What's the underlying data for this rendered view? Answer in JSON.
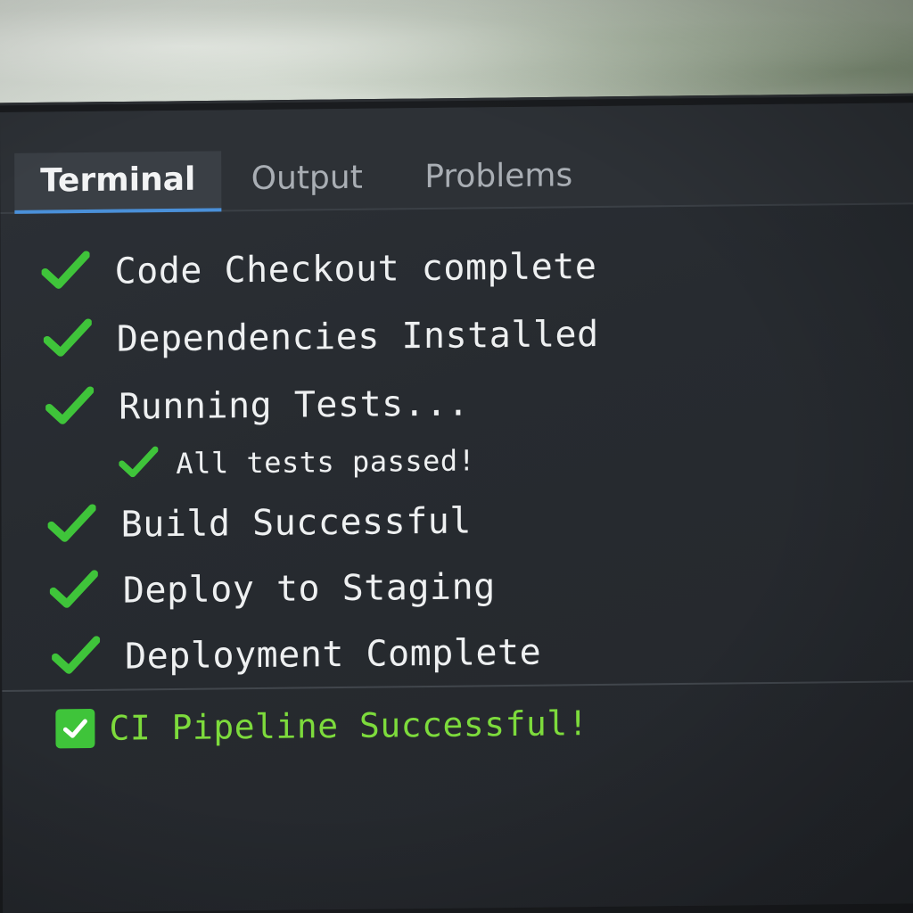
{
  "tabs": {
    "terminal": "Terminal",
    "output": "Output",
    "problems": "Problems"
  },
  "steps": [
    {
      "label": "Code Checkout complete",
      "status": "success"
    },
    {
      "label": "Dependencies Installed",
      "status": "success"
    },
    {
      "label": "Running Tests...",
      "status": "success"
    },
    {
      "label": "All tests passed!",
      "status": "success",
      "nested": true
    },
    {
      "label": "Build Successful",
      "status": "success"
    },
    {
      "label": "Deploy to Staging",
      "status": "success"
    },
    {
      "label": "Deployment Complete",
      "status": "success"
    }
  ],
  "summary": {
    "label": "CI Pipeline Successful!",
    "icon": "checkbox-checked-icon"
  },
  "colors": {
    "check": "#3fc43a",
    "summary_text": "#7ddb3c",
    "active_tab_underline": "#4a90d9",
    "background": "#272b30"
  }
}
